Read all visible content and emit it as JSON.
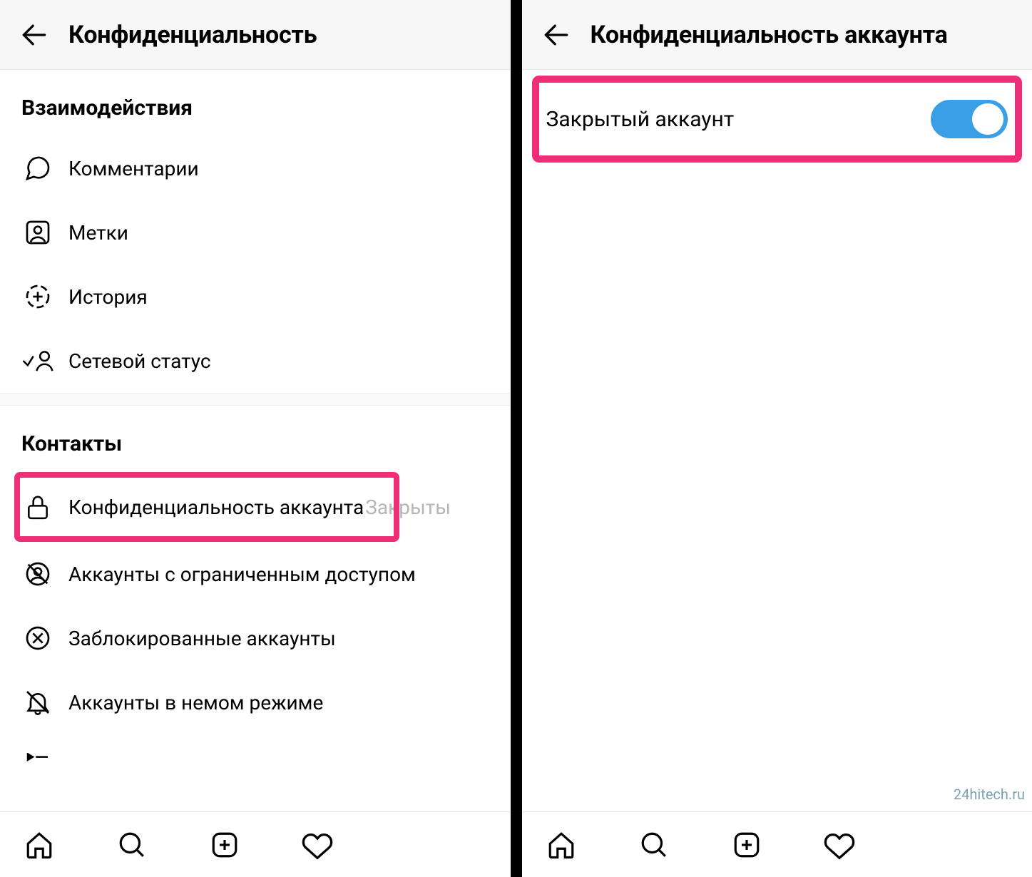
{
  "left": {
    "header_title": "Конфиденциальность",
    "section1_title": "Взаимодействия",
    "items1": [
      {
        "label": "Комментарии"
      },
      {
        "label": "Метки"
      },
      {
        "label": "История"
      },
      {
        "label": "Сетевой статус"
      }
    ],
    "section2_title": "Контакты",
    "items2": [
      {
        "label": "Конфиденциальность аккаунта",
        "sub": "Закрыты"
      },
      {
        "label": "Аккаунты с ограниченным доступом"
      },
      {
        "label": "Заблокированные аккаунты"
      },
      {
        "label": "Аккаунты в немом режиме"
      }
    ]
  },
  "right": {
    "header_title": "Конфиденциальность аккаунта",
    "toggle_label": "Закрытый аккаунт",
    "toggle_on": true
  },
  "watermark": "24hitech.ru"
}
